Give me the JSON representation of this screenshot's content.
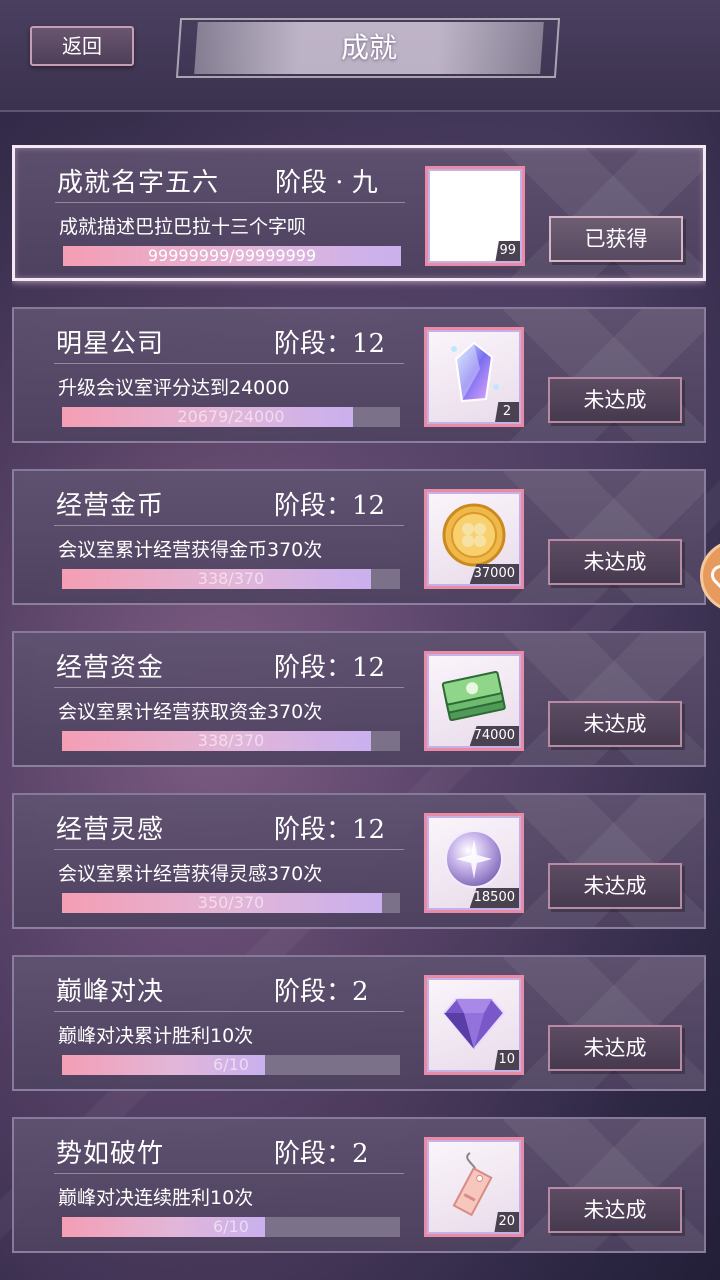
{
  "header": {
    "back_label": "返回",
    "title": "成就"
  },
  "achievements": [
    {
      "name": "成就名字五六",
      "stage": "阶段 · 九",
      "desc": "成就描述巴拉巴拉十三个字呗",
      "progress_text": "99999999/99999999",
      "progress": 1.0,
      "reward_icon": "blank-icon",
      "reward_count": "99",
      "status": "已获得",
      "claimed": true
    },
    {
      "name": "明星公司",
      "stage": "阶段：12",
      "desc": "升级会议室评分达到24000",
      "progress_text": "20679/24000",
      "progress": 0.862,
      "reward_icon": "crystal-icon",
      "reward_count": "2",
      "status": "未达成",
      "claimed": false
    },
    {
      "name": "经营金币",
      "stage": "阶段：12",
      "desc": "会议室累计经营获得金币370次",
      "progress_text": "338/370",
      "progress": 0.914,
      "reward_icon": "gold-coin-icon",
      "reward_count": "37000",
      "status": "未达成",
      "claimed": false
    },
    {
      "name": "经营资金",
      "stage": "阶段：12",
      "desc": "会议室累计经营获取资金370次",
      "progress_text": "338/370",
      "progress": 0.914,
      "reward_icon": "cash-stack-icon",
      "reward_count": "74000",
      "status": "未达成",
      "claimed": false
    },
    {
      "name": "经营灵感",
      "stage": "阶段：12",
      "desc": "会议室累计经营获得灵感370次",
      "progress_text": "350/370",
      "progress": 0.946,
      "reward_icon": "inspiration-orb-icon",
      "reward_count": "18500",
      "status": "未达成",
      "claimed": false
    },
    {
      "name": "巅峰对决",
      "stage": "阶段：2",
      "desc": "巅峰对决累计胜利10次",
      "progress_text": "6/10",
      "progress": 0.6,
      "reward_icon": "purple-diamond-icon",
      "reward_count": "10",
      "status": "未达成",
      "claimed": false
    },
    {
      "name": "势如破竹",
      "stage": "阶段：2",
      "desc": "巅峰对决连续胜利10次",
      "progress_text": "6/10",
      "progress": 0.6,
      "reward_icon": "tag-icon",
      "reward_count": "20",
      "status": "未达成",
      "claimed": false
    }
  ],
  "colors": {
    "accent_pink": "#f49eb4",
    "accent_lavender": "#c9b0ee",
    "card_bg": "#5f5270"
  }
}
